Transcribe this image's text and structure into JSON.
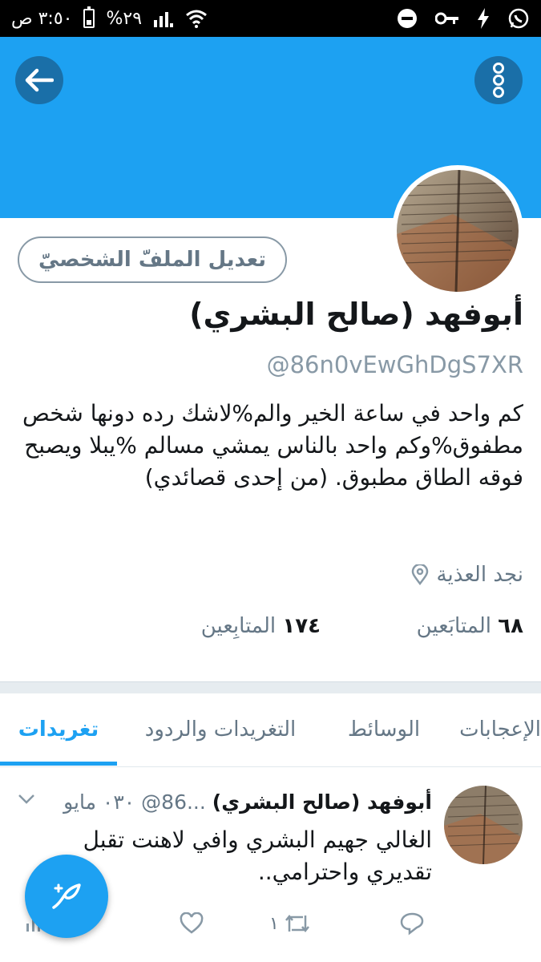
{
  "status_bar": {
    "time": "٣:٥٠ ص",
    "battery": "%٢٩"
  },
  "header": {
    "back_icon": "arrow-left-icon",
    "more_icon": "more-vertical-icon"
  },
  "profile": {
    "edit_label": "تعديل الملفّ الشخصيّ",
    "name": "أبوفهد (صالح البشري)",
    "handle": "@86n0vEwGhDgS7XR",
    "bio": "كم واحد في ساعة الخير والم%لاشك رده دونها شخص مطفوق%وكم واحد بالناس يمشي مسالم %يبلا ويصبح فوقه الطاق مطبوق.  (من إحدى قصائدي)",
    "location": "نجد العذية",
    "following_count": "٦٨",
    "following_label": "المتابَعين",
    "followers_count": "١٧٤",
    "followers_label": "المتابِعين"
  },
  "tabs": [
    {
      "label": "تغريدات",
      "active": true
    },
    {
      "label": "التغريدات والردود",
      "active": false
    },
    {
      "label": "الوسائط",
      "active": false
    },
    {
      "label": "الإعجابات",
      "active": false
    }
  ],
  "tweet": {
    "name": "أبوفهد (صالح البشري)",
    "meta": "...86@ ٠٣٠ مايو",
    "text": "الغالي جهيم البشري وافي لاهنت تقبل تقديري واحترامي..",
    "retweet_count": "١"
  },
  "colors": {
    "brand": "#1da1f2",
    "icon_dark": "#1a6fa8",
    "muted": "#657786"
  }
}
